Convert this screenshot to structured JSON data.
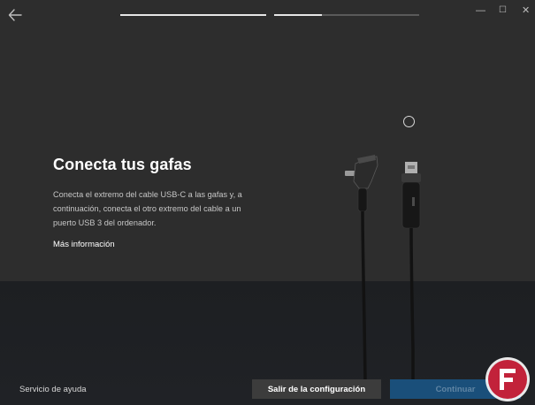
{
  "window": {
    "minimize_label": "—",
    "maximize_label": "☐",
    "close_label": "✕"
  },
  "header": {
    "back_icon": "back-arrow-icon"
  },
  "progress": [
    {
      "fraction": 1.0
    },
    {
      "fraction": 0.33
    }
  ],
  "main": {
    "title": "Conecta tus gafas",
    "description": "Conecta el extremo del cable USB-C a las gafas y, a continuación, conecta el otro extremo del cable a un puerto USB 3 del ordenador.",
    "more_info_link": "Más información"
  },
  "footer": {
    "help_link": "Servicio de ayuda",
    "exit_button": "Salir de la configuración",
    "continue_button": "Continuar"
  },
  "colors": {
    "accent": "#1a4f7a",
    "watermark": "#c2223a"
  }
}
